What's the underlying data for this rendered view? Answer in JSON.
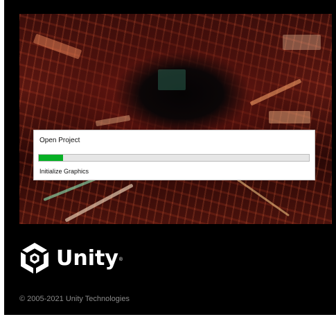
{
  "dialog": {
    "title": "Open Project",
    "status": "Initialize Graphics",
    "progress_fraction": 0.09,
    "progress_color": "#06b025"
  },
  "brand": {
    "logo_icon": "unity-cube-icon",
    "name": "Unity",
    "registered_mark": "®"
  },
  "footer": {
    "copyright": "© 2005-2021 Unity Technologies"
  },
  "colors": {
    "background": "#000000",
    "copyright_text": "#8a8a8a"
  }
}
